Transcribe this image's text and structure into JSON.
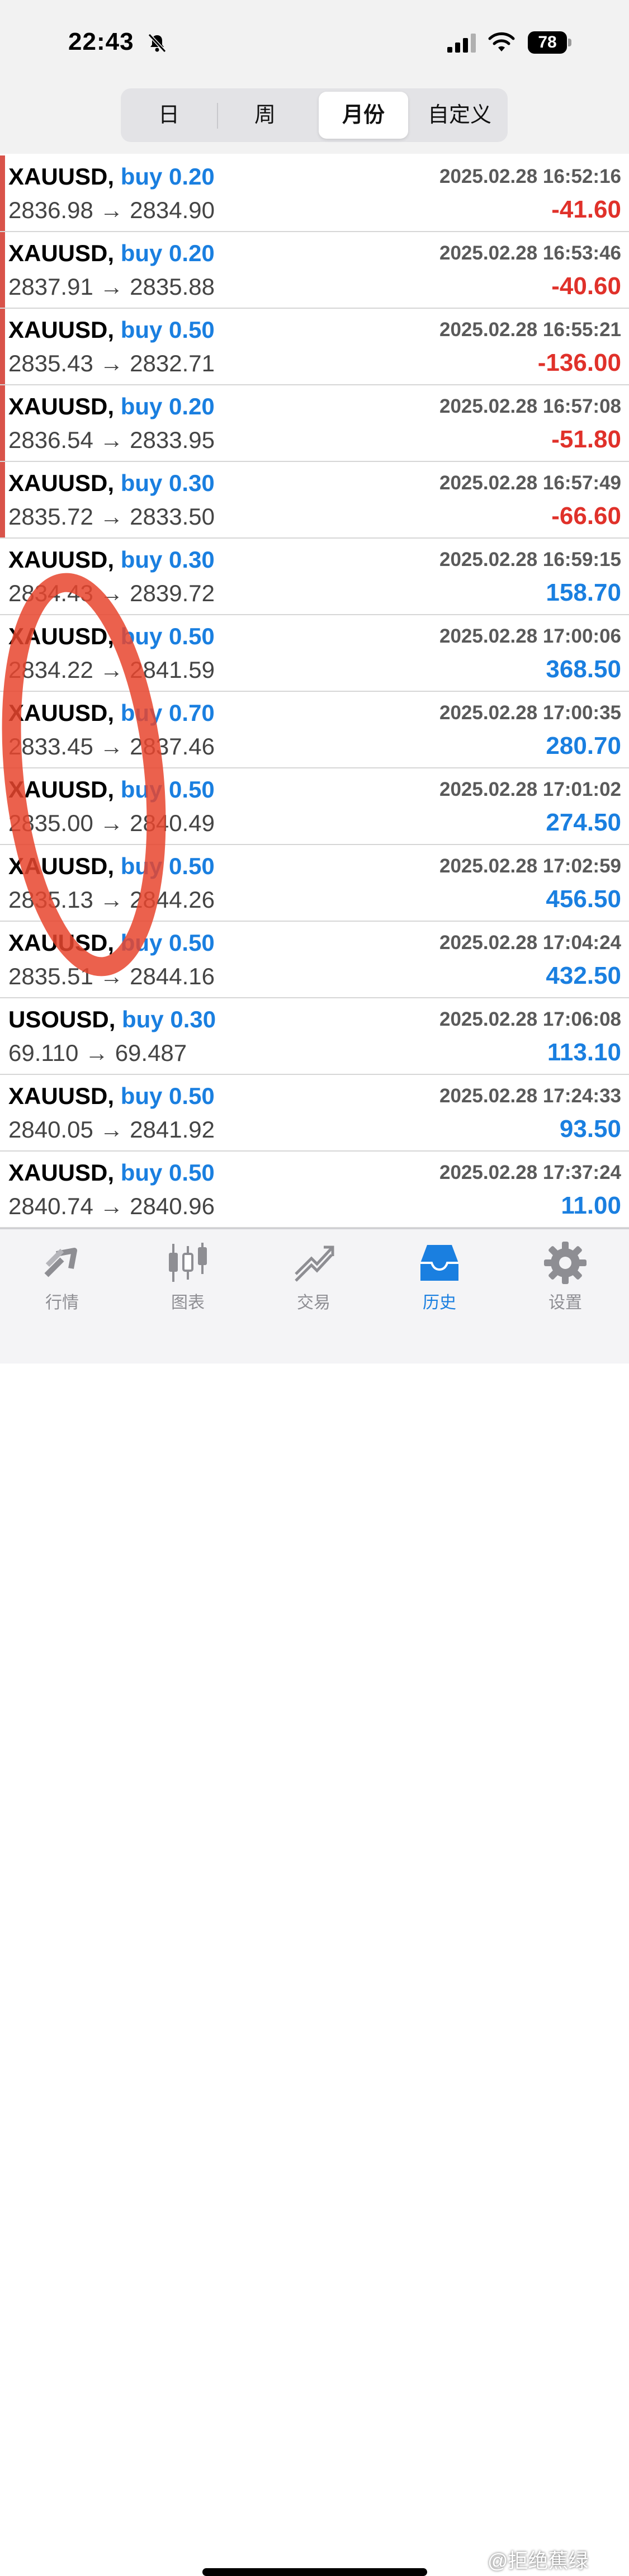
{
  "status_bar": {
    "time": "22:43",
    "battery": "78"
  },
  "segments": [
    {
      "label": "日",
      "active": false
    },
    {
      "label": "周",
      "active": false
    },
    {
      "label": "月份",
      "active": true
    },
    {
      "label": "自定义",
      "active": false
    }
  ],
  "colors": {
    "loss": "#e0312a",
    "gain": "#1a7fe0",
    "side": "#1a7fe0",
    "annotation": "#e8452e"
  },
  "trades": [
    {
      "symbol": "XAUUSD,",
      "side": "buy",
      "volume": "0.20",
      "datetime": "2025.02.28 16:52:16",
      "open": "2836.98",
      "close": "2834.90",
      "profit": "-41.60",
      "status": "loss"
    },
    {
      "symbol": "XAUUSD,",
      "side": "buy",
      "volume": "0.20",
      "datetime": "2025.02.28 16:53:46",
      "open": "2837.91",
      "close": "2835.88",
      "profit": "-40.60",
      "status": "loss"
    },
    {
      "symbol": "XAUUSD,",
      "side": "buy",
      "volume": "0.50",
      "datetime": "2025.02.28 16:55:21",
      "open": "2835.43",
      "close": "2832.71",
      "profit": "-136.00",
      "status": "loss"
    },
    {
      "symbol": "XAUUSD,",
      "side": "buy",
      "volume": "0.20",
      "datetime": "2025.02.28 16:57:08",
      "open": "2836.54",
      "close": "2833.95",
      "profit": "-51.80",
      "status": "loss"
    },
    {
      "symbol": "XAUUSD,",
      "side": "buy",
      "volume": "0.30",
      "datetime": "2025.02.28 16:57:49",
      "open": "2835.72",
      "close": "2833.50",
      "profit": "-66.60",
      "status": "loss"
    },
    {
      "symbol": "XAUUSD,",
      "side": "buy",
      "volume": "0.30",
      "datetime": "2025.02.28 16:59:15",
      "open": "2834.43",
      "close": "2839.72",
      "profit": "158.70",
      "status": "gain"
    },
    {
      "symbol": "XAUUSD,",
      "side": "buy",
      "volume": "0.50",
      "datetime": "2025.02.28 17:00:06",
      "open": "2834.22",
      "close": "2841.59",
      "profit": "368.50",
      "status": "gain"
    },
    {
      "symbol": "XAUUSD,",
      "side": "buy",
      "volume": "0.70",
      "datetime": "2025.02.28 17:00:35",
      "open": "2833.45",
      "close": "2837.46",
      "profit": "280.70",
      "status": "gain"
    },
    {
      "symbol": "XAUUSD,",
      "side": "buy",
      "volume": "0.50",
      "datetime": "2025.02.28 17:01:02",
      "open": "2835.00",
      "close": "2840.49",
      "profit": "274.50",
      "status": "gain"
    },
    {
      "symbol": "XAUUSD,",
      "side": "buy",
      "volume": "0.50",
      "datetime": "2025.02.28 17:02:59",
      "open": "2835.13",
      "close": "2844.26",
      "profit": "456.50",
      "status": "gain"
    },
    {
      "symbol": "XAUUSD,",
      "side": "buy",
      "volume": "0.50",
      "datetime": "2025.02.28 17:04:24",
      "open": "2835.51",
      "close": "2844.16",
      "profit": "432.50",
      "status": "gain"
    },
    {
      "symbol": "USOUSD,",
      "side": "buy",
      "volume": "0.30",
      "datetime": "2025.02.28 17:06:08",
      "open": "69.110",
      "close": "69.487",
      "profit": "113.10",
      "status": "gain"
    },
    {
      "symbol": "XAUUSD,",
      "side": "buy",
      "volume": "0.50",
      "datetime": "2025.02.28 17:24:33",
      "open": "2840.05",
      "close": "2841.92",
      "profit": "93.50",
      "status": "gain"
    },
    {
      "symbol": "XAUUSD,",
      "side": "buy",
      "volume": "0.50",
      "datetime": "2025.02.28 17:37:24",
      "open": "2840.74",
      "close": "2840.96",
      "profit": "11.00",
      "status": "gain"
    }
  ],
  "arrow": "→",
  "tabs": [
    {
      "label": "行情",
      "icon": "quotes-icon",
      "active": false
    },
    {
      "label": "图表",
      "icon": "chart-icon",
      "active": false
    },
    {
      "label": "交易",
      "icon": "trade-icon",
      "active": false
    },
    {
      "label": "历史",
      "icon": "history-icon",
      "active": true
    },
    {
      "label": "设置",
      "icon": "settings-icon",
      "active": false
    }
  ],
  "watermark": "@拒绝蕉绿"
}
